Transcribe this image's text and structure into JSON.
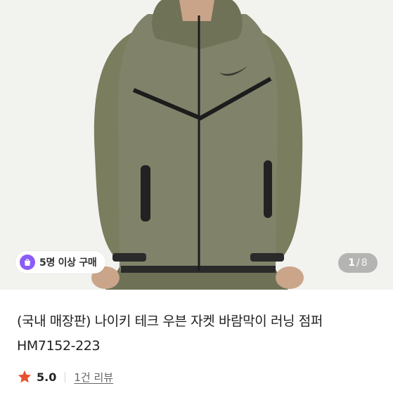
{
  "product": {
    "image_alt": "khaki windbreaker jacket",
    "purchase_badge": {
      "icon": "shopping-bag-icon",
      "text": "5명 이상 구매",
      "icon_color": "#8b5cf6"
    },
    "image_counter": {
      "current": "1",
      "separator": "/",
      "total": "8"
    },
    "title": "(국내 매장판) 나이키 테크 우븐 자켓 바람막이 러닝 점퍼 HM7152-223",
    "rating": {
      "icon": "star-icon",
      "icon_color": "#e8502e",
      "value": "5.0"
    },
    "review_link": "1건 리뷰"
  }
}
